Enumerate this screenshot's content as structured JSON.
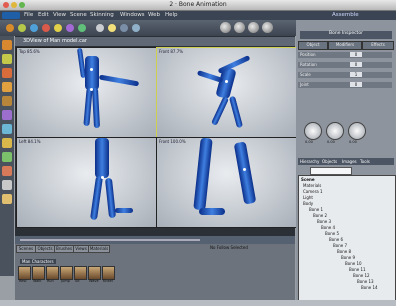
{
  "window": {
    "title": "2 · Bone Animation"
  },
  "menu": {
    "items": [
      "File",
      "Edit",
      "View",
      "Scene",
      "Skinning",
      "Windows",
      "Web",
      "Help"
    ],
    "right_label": "Assemble"
  },
  "viewport": {
    "title": "3DView of Man model.car",
    "views": [
      {
        "label": "Top 85.6%"
      },
      {
        "label": "Front 87.7%"
      },
      {
        "label": "Left 84.1%"
      },
      {
        "label": "Front 100.0%"
      }
    ]
  },
  "right_panel": {
    "header": "Bone Inspector",
    "tabs": [
      "Object",
      "Modifiers",
      "Effects"
    ],
    "rows": [
      {
        "label": "Position",
        "value": "0"
      },
      {
        "label": "Rotation",
        "value": "0"
      },
      {
        "label": "Scale",
        "value": "1"
      },
      {
        "label": "Joint",
        "value": "0"
      }
    ],
    "dial_values": [
      "0.00",
      "0.00",
      "0.00"
    ],
    "hierarchy_tabs": [
      "Hierarchy",
      "Objects",
      "Images",
      "Tools"
    ],
    "hierarchy_root": "Scene",
    "hierarchy_items": [
      "Materials",
      "Camera 1",
      "Light",
      "Body",
      "Bone 1",
      "Bone 2",
      "Bone 3",
      "Bone 4",
      "Bone 5",
      "Bone 6",
      "Bone 7",
      "Bone 8",
      "Bone 9",
      "Bone 10",
      "Bone 11",
      "Bone 12",
      "Bone 13",
      "Bone 14"
    ]
  },
  "bottom": {
    "tabs": [
      "Scenes",
      "Objects",
      "Brushes",
      "Views",
      "Materials"
    ],
    "status": "No Follow Selected",
    "library_header": "Man Characters",
    "thumbs": [
      "Rest",
      "Walk",
      "Run",
      "Jump",
      "Sit",
      "Wave",
      "Kneel"
    ]
  },
  "colors": {
    "accent": "#1f5fa8",
    "model": "#2f6fd8",
    "panel": "#8d949d"
  }
}
